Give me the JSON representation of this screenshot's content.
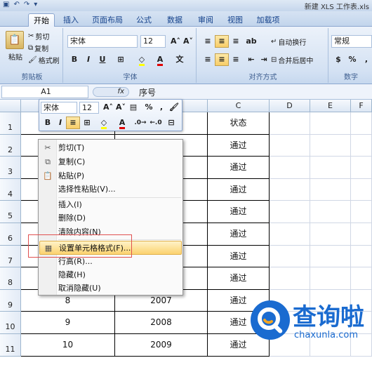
{
  "titlebar": {
    "title": "新建 XLS 工作表.xls"
  },
  "tabs": [
    {
      "label": "开始",
      "active": true
    },
    {
      "label": "插入"
    },
    {
      "label": "页面布局"
    },
    {
      "label": "公式"
    },
    {
      "label": "数据"
    },
    {
      "label": "审阅"
    },
    {
      "label": "视图"
    },
    {
      "label": "加载项"
    }
  ],
  "ribbon": {
    "clipboard": {
      "paste": "粘贴",
      "cut": "剪切",
      "copy": "复制",
      "format_painter": "格式刷",
      "group": "剪贴板"
    },
    "font": {
      "name": "宋体",
      "size": "12",
      "group": "字体"
    },
    "alignment": {
      "wrap": "自动换行",
      "merge": "合并后居中",
      "group": "对齐方式"
    },
    "number": {
      "format": "常规",
      "percent": "%",
      "comma": ",",
      "group": "数字"
    }
  },
  "formula_bar": {
    "name_box": "A1",
    "fx": "fx",
    "value": "序号"
  },
  "columns": [
    "C",
    "D",
    "E",
    "F"
  ],
  "rows": [
    {
      "n": "1",
      "a": "",
      "b": "",
      "c": "状态"
    },
    {
      "n": "2",
      "a": "",
      "b": "",
      "c": "通过"
    },
    {
      "n": "3",
      "a": "",
      "b": "",
      "c": "通过"
    },
    {
      "n": "4",
      "a": "",
      "b": "",
      "c": "通过"
    },
    {
      "n": "5",
      "a": "",
      "b": "",
      "c": "通过"
    },
    {
      "n": "6",
      "a": "",
      "b": "",
      "c": "通过"
    },
    {
      "n": "7",
      "a": "",
      "b": "",
      "c": "通过"
    },
    {
      "n": "8",
      "a": "",
      "b": "",
      "c": "通过"
    },
    {
      "n": "9",
      "a": "8",
      "b": "2007",
      "c": "通过"
    },
    {
      "n": "10",
      "a": "9",
      "b": "2008",
      "c": "通过"
    },
    {
      "n": "11",
      "a": "10",
      "b": "2009",
      "c": "通过"
    }
  ],
  "mini_toolbar": {
    "font": "宋体",
    "size": "12",
    "percent": "%",
    "comma": ","
  },
  "context_menu": {
    "items": [
      {
        "label": "剪切(T)"
      },
      {
        "label": "复制(C)"
      },
      {
        "label": "粘贴(P)"
      },
      {
        "label": "选择性粘贴(V)..."
      },
      {
        "label": "插入(I)"
      },
      {
        "label": "删除(D)"
      },
      {
        "label": "清除内容(N)"
      },
      {
        "label": "设置单元格格式(F)...",
        "highlight": true
      },
      {
        "label": "行高(R)..."
      },
      {
        "label": "隐藏(H)"
      },
      {
        "label": "取消隐藏(U)"
      }
    ]
  },
  "watermark": {
    "cn": "查询啦",
    "url": "chaxunla.com"
  },
  "colors": {
    "accent": "#15428b",
    "highlight": "#fbd26f",
    "watermark": "#1a6bd0"
  }
}
